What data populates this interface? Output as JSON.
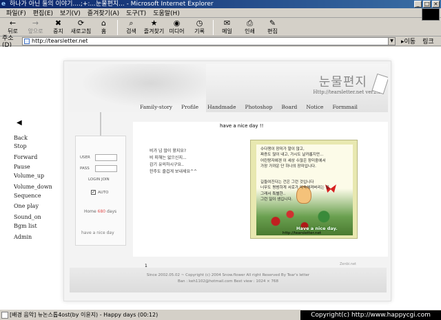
{
  "window": {
    "title": "하나가 아닌 둘의 이야기....;+:...눈물편지... - Microsoft Internet Explorer",
    "icon": "ie-icon"
  },
  "menu": [
    "파일(F)",
    "편집(E)",
    "보기(V)",
    "즐겨찾기(A)",
    "도구(T)",
    "도움말(H)"
  ],
  "toolbar": [
    {
      "label": "뒤로",
      "icon": "back-arrow-icon",
      "glyph": "←",
      "enabled": true
    },
    {
      "label": "앞으로",
      "icon": "forward-arrow-icon",
      "glyph": "→",
      "enabled": false
    },
    {
      "label": "중지",
      "icon": "stop-icon",
      "glyph": "✖",
      "enabled": true
    },
    {
      "label": "새로고침",
      "icon": "refresh-icon",
      "glyph": "⟳",
      "enabled": true
    },
    {
      "label": "홈",
      "icon": "home-icon",
      "glyph": "⌂",
      "enabled": true
    },
    {
      "label": "검색",
      "icon": "search-icon",
      "glyph": "⌕",
      "enabled": true
    },
    {
      "label": "즐겨찾기",
      "icon": "favorites-icon",
      "glyph": "★",
      "enabled": true
    },
    {
      "label": "미디어",
      "icon": "media-icon",
      "glyph": "◉",
      "enabled": true
    },
    {
      "label": "기록",
      "icon": "history-icon",
      "glyph": "◷",
      "enabled": true
    },
    {
      "label": "메일",
      "icon": "mail-icon",
      "glyph": "✉",
      "enabled": true
    },
    {
      "label": "인쇄",
      "icon": "print-icon",
      "glyph": "⎙",
      "enabled": true
    },
    {
      "label": "편집",
      "icon": "edit-icon",
      "glyph": "✎",
      "enabled": true
    }
  ],
  "address": {
    "label": "주소(D)",
    "url": "http://tearsletter.net",
    "go": "이동",
    "links": "링크"
  },
  "sidenav": [
    "Back",
    "Stop",
    "Forward",
    "Pause",
    "Volume_up",
    "Volume_down",
    "Sequence",
    "One play",
    "Sound_on",
    "Bgm list",
    "Admin"
  ],
  "site": {
    "logo": "눈물편지",
    "logo_url": "Http://tearsletter.net  ver2.5",
    "nav": [
      "Family-story",
      "Profile",
      "Handmade",
      "Photoshop",
      "Board",
      "Notice",
      "Formmail"
    ]
  },
  "login": {
    "user": "USER",
    "pass": "PASS",
    "login_join": "LOGIN  JOIN",
    "auto": "AUTO",
    "auto_check": "✓",
    "home_prefix": "Home ",
    "home_days": "680",
    "home_suffix": " days",
    "nice": "have a nice day"
  },
  "main": {
    "title": "have a nice day !!",
    "poem": [
      "비가 넘 많이 왔지요?",
      "비 피해는 없으신지...",
      "감기 유의하시구요..",
      "한주도 즐겁게 보내세요^^"
    ],
    "card_top": [
      "수다쟁이 장미가 말이 많고,",
      "짜증도 많이 내고, 가시도 날카롭지만...",
      "어린왕자에겐 이 세상 수많은 장미중에서",
      "가장 가까운 단 하나의 장미입니다."
    ],
    "card_mid": [
      "길들여진다는 건은 그런 것입니다",
      "너무도 평범하게 서로가 익숙해져버리는 일.",
      "그래서 특별한..",
      "그런 일이 생깁니다."
    ],
    "card_banner": "Have a nice day.",
    "card_url": "http://tearsletter.net",
    "page_num": "1"
  },
  "footer": {
    "line1": "Since 2002.05.02 ~ Copyright (c) 2004 Snow.flower All right Reserved By Tear's letter",
    "line2": "Ban : keh1102@hotmail.com   Best view : 1024 × 768",
    "zenbi": "Zenbi.net"
  },
  "status": {
    "text": "[배경 음악] 뉴논스톱4ost(by 이윤지) - Happy days (00:12)"
  },
  "copyright": "Copyright(c) http://www.happycgi.com"
}
